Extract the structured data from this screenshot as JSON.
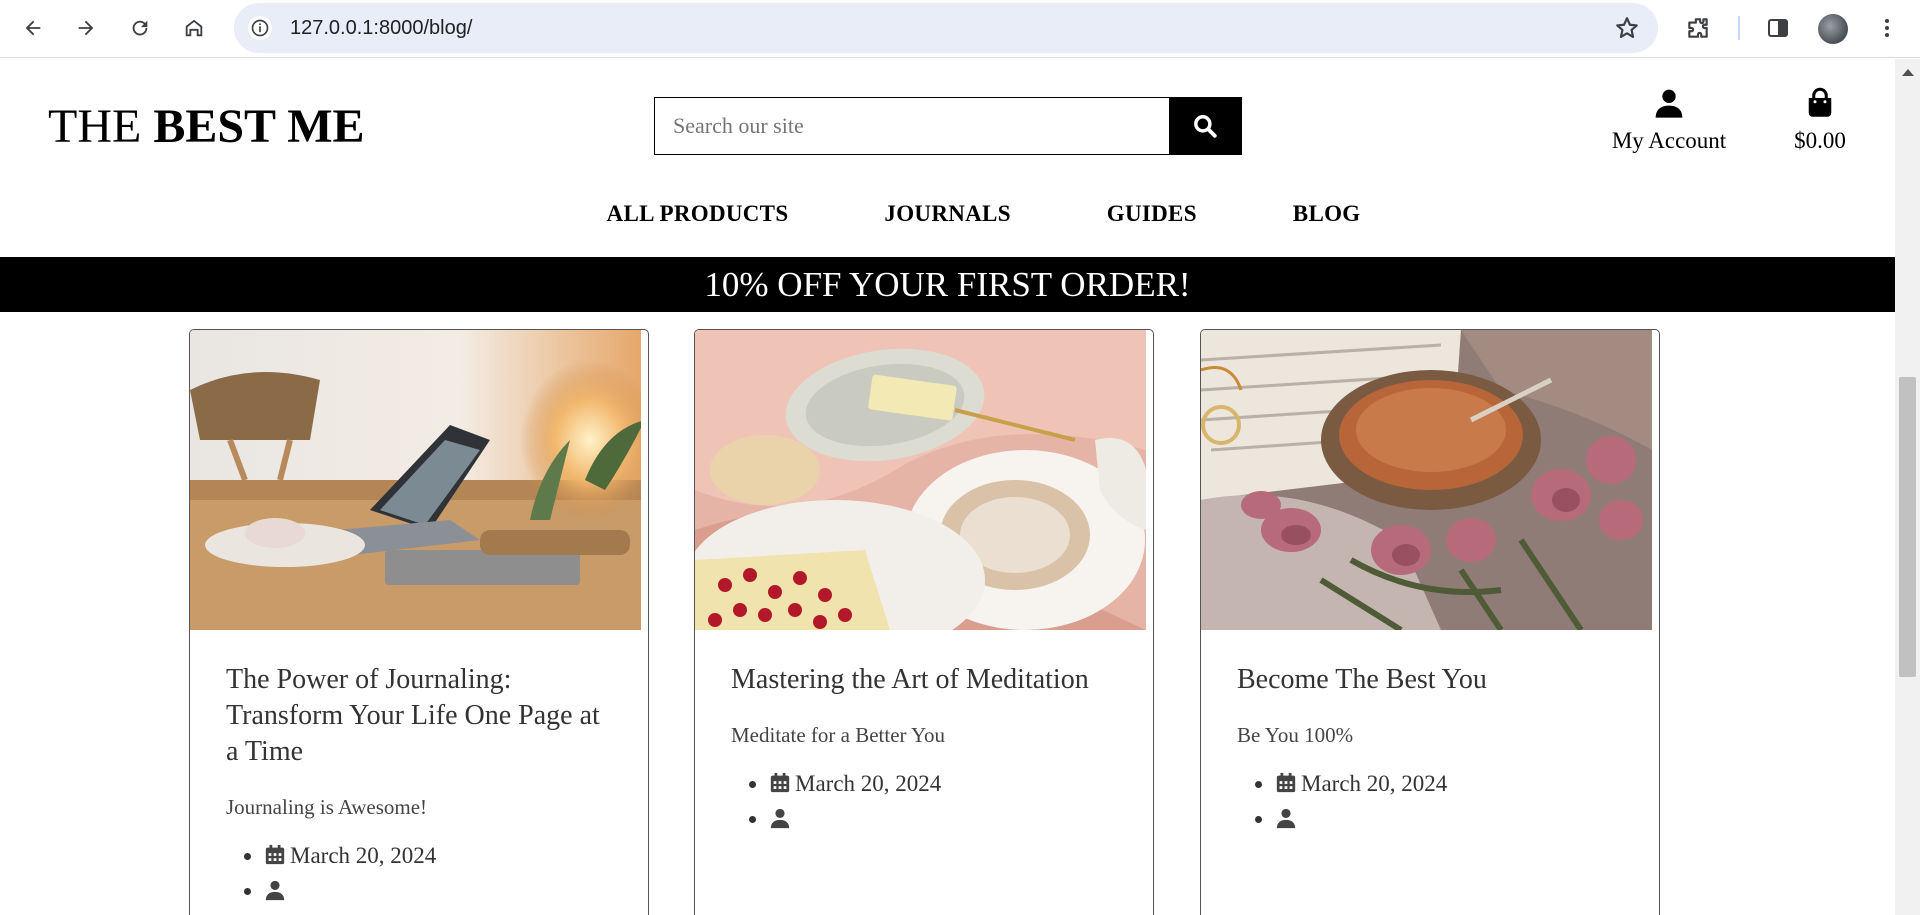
{
  "browser": {
    "url": "127.0.0.1:8000/blog/"
  },
  "site": {
    "logo_part1": "THE ",
    "logo_part2": "BEST ME",
    "search_placeholder": "Search our site",
    "account_label": "My Account",
    "cart_total": "$0.00"
  },
  "nav": {
    "items": [
      "ALL PRODUCTS",
      "JOURNALS",
      "GUIDES",
      "BLOG"
    ]
  },
  "banner": {
    "text": "10% OFF YOUR FIRST ORDER!"
  },
  "posts": [
    {
      "title": "The Power of Journaling: Transform Your Life One Page at a Time",
      "excerpt": "Journaling is Awesome!",
      "date": "March 20, 2024",
      "author": ""
    },
    {
      "title": "Mastering the Art of Meditation",
      "excerpt": "Meditate for a Better You",
      "date": "March 20, 2024",
      "author": ""
    },
    {
      "title": "Become The Best You",
      "excerpt": "Be You 100%",
      "date": "March 20, 2024",
      "author": ""
    }
  ]
}
